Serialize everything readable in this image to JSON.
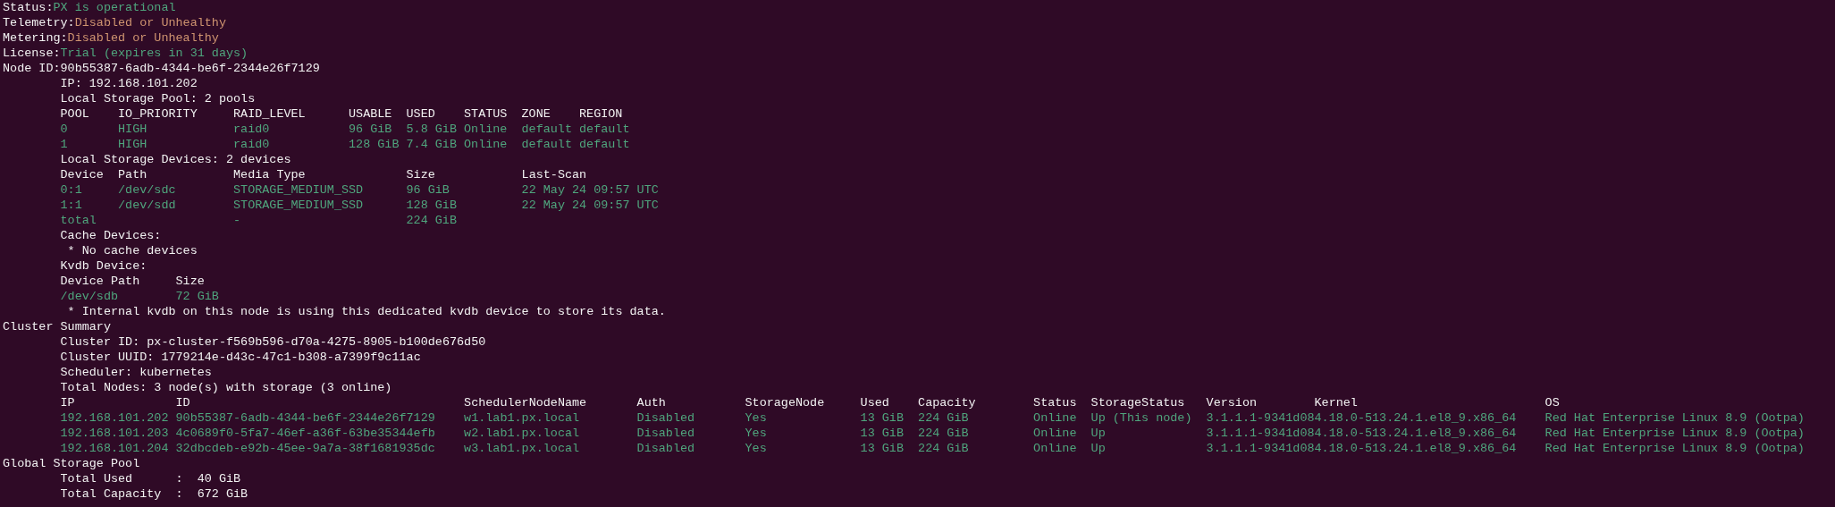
{
  "summary": [
    {
      "label": "Status:",
      "value": "PX is operational",
      "kind": "ok"
    },
    {
      "label": "Telemetry:",
      "value": "Disabled or Unhealthy",
      "kind": "warn"
    },
    {
      "label": "Metering:",
      "value": "Disabled or Unhealthy",
      "kind": "warn"
    },
    {
      "label": "License:",
      "value": "Trial (expires in 31 days)",
      "kind": "ok"
    },
    {
      "label": "Node ID:",
      "value": "90b55387-6adb-4344-be6f-2344e26f7129",
      "kind": "plain"
    }
  ],
  "node": {
    "ip": "IP: 192.168.101.202",
    "pool_summary": "Local Storage Pool: 2 pools",
    "pools": {
      "columns": [
        "POOL",
        "IO_PRIORITY",
        "RAID_LEVEL",
        "USABLE",
        "USED",
        "STATUS",
        "ZONE",
        "REGION"
      ],
      "rows": [
        [
          "0",
          "HIGH",
          "raid0",
          "96 GiB",
          "5.8 GiB",
          "Online",
          "default",
          "default"
        ],
        [
          "1",
          "HIGH",
          "raid0",
          "128 GiB",
          "7.4 GiB",
          "Online",
          "default",
          "default"
        ]
      ]
    },
    "devices_summary": "Local Storage Devices: 2 devices",
    "devices": {
      "columns": [
        "Device",
        "Path",
        "Media Type",
        "Size",
        "Last-Scan"
      ],
      "rows": [
        [
          "0:1",
          "/dev/sdc",
          "STORAGE_MEDIUM_SSD",
          "96 GiB",
          "22 May 24 09:57 UTC"
        ],
        [
          "1:1",
          "/dev/sdd",
          "STORAGE_MEDIUM_SSD",
          "128 GiB",
          "22 May 24 09:57 UTC"
        ],
        [
          "total",
          null,
          "-",
          "224 GiB",
          null
        ]
      ]
    },
    "cache_heading": "Cache Devices:",
    "cache_note": "* No cache devices",
    "kvdb_heading": "Kvdb Device:",
    "kvdb": {
      "columns": [
        "Device Path",
        "Size"
      ],
      "rows": [
        [
          "/dev/sdb",
          "72 GiB"
        ]
      ]
    },
    "kvdb_note": "* Internal kvdb on this node is using this dedicated kvdb device to store its data."
  },
  "cluster": {
    "heading": "Cluster Summary",
    "details": [
      "Cluster ID: px-cluster-f569b596-d70a-4275-8905-b100de676d50",
      "Cluster UUID: 1779214e-d43c-47c1-b308-a7399f9c11ac",
      "Scheduler: kubernetes",
      "Total Nodes: 3 node(s) with storage (3 online)"
    ],
    "nodes": {
      "columns": [
        "IP",
        "ID",
        "SchedulerNodeName",
        "Auth",
        "StorageNode",
        "Used",
        "Capacity",
        "Status",
        "StorageStatus",
        "Version",
        "Kernel",
        "OS"
      ],
      "rows": [
        [
          "192.168.101.202",
          "90b55387-6adb-4344-be6f-2344e26f7129",
          "w1.lab1.px.local",
          "Disabled",
          "Yes",
          "13 GiB",
          "224 GiB",
          "Online",
          "Up (This node)",
          "3.1.1.1-9341d08",
          "4.18.0-513.24.1.el8_9.x86_64",
          "Red Hat Enterprise Linux 8.9 (Ootpa)"
        ],
        [
          "192.168.101.203",
          "4c0689f0-5fa7-46ef-a36f-63be35344efb",
          "w2.lab1.px.local",
          "Disabled",
          "Yes",
          "13 GiB",
          "224 GiB",
          "Online",
          "Up",
          "3.1.1.1-9341d08",
          "4.18.0-513.24.1.el8_9.x86_64",
          "Red Hat Enterprise Linux 8.9 (Ootpa)"
        ],
        [
          "192.168.101.204",
          "32dbcdeb-e92b-45ee-9a7a-38f1681935dc",
          "w3.lab1.px.local",
          "Disabled",
          "Yes",
          "13 GiB",
          "224 GiB",
          "Online",
          "Up",
          "3.1.1.1-9341d08",
          "4.18.0-513.24.1.el8_9.x86_64",
          "Red Hat Enterprise Linux 8.9 (Ootpa)"
        ]
      ]
    }
  },
  "global_pool": {
    "heading": "Global Storage Pool",
    "lines": [
      "Total Used      :  40 GiB",
      "Total Capacity  :  672 GiB"
    ]
  }
}
